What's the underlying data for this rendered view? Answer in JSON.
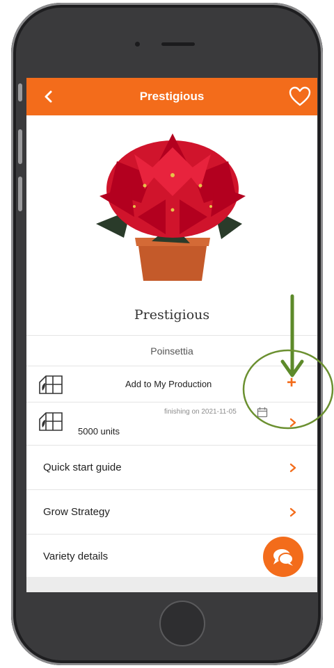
{
  "app": {
    "title": "Prestigious",
    "accent_color": "#f36c1b",
    "icons": {
      "back": "chevron-left-icon",
      "favorite": "heart-icon",
      "greenhouse": "greenhouse-icon",
      "calendar": "calendar-icon",
      "add": "plus-icon",
      "chevron": "chevron-right-icon",
      "chat": "chat-icon"
    }
  },
  "product": {
    "name": "Prestigious",
    "species": "Poinsettia"
  },
  "production": {
    "add_label": "Add to My Production",
    "add_symbol": "+",
    "finishing_text": "finishing on 2021-11-05",
    "units_text": "5000 units"
  },
  "menu": [
    {
      "label": "Quick start guide"
    },
    {
      "label": "Grow Strategy"
    },
    {
      "label": "Variety details"
    }
  ]
}
